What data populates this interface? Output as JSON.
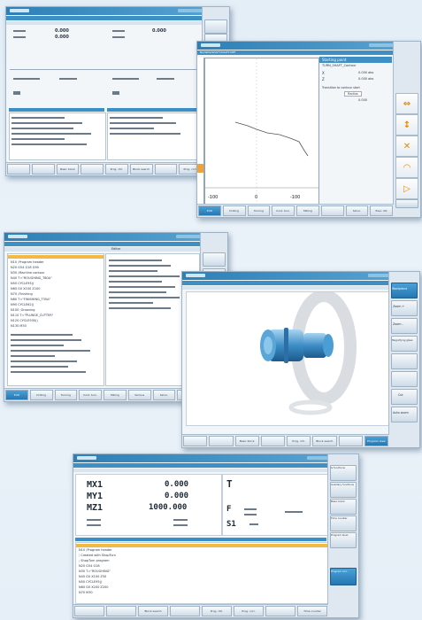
{
  "screen1": {
    "values": [
      "0.000",
      "0.000",
      "0.000"
    ],
    "side_labels": [
      "Machine",
      "Position",
      "Set value"
    ],
    "hbar": [
      "",
      "",
      "Basic block",
      "",
      "Prog. ctrl.",
      "Block search",
      "",
      "Prog. corr."
    ]
  },
  "screen2": {
    "header": "NC/WKS/SHAFT/SHAFT.MPF",
    "panel_title": "Starting point",
    "panel_sub": "TURN_SHAFT_Contour",
    "fields": [
      {
        "label": "X",
        "value": "0.000 abs"
      },
      {
        "label": "Z",
        "value": "0.000 abs"
      }
    ],
    "transition_title": "Transition to contour start",
    "transition_value": "Radius",
    "r_value": "0.000",
    "axis_ticks": [
      "-100",
      "0",
      "-100"
    ],
    "side_icons": [
      "⇔",
      "↕",
      "✕",
      "◠",
      "▷"
    ],
    "hbar": [
      "Edit",
      "Drilling",
      "Turning",
      "Cont. turn.",
      "Milling",
      "",
      "Simul.",
      "Exec. NC"
    ]
  },
  "screen3": {
    "title": "Editor",
    "lines": [
      "N10 ;Program header",
      "N20 G54 G18 G90",
      "N30 ;Machine contour",
      "N40 T=\"ROUGHING_T80A\"",
      "N50 CYCLE95()",
      "N60 G0 X100 Z100",
      "N70 ;Finishing",
      "N80 T=\"FINISHING_T35A\"",
      "N90 CYCLE62()",
      "N100 ;Grooving",
      "N110 T=\"PLUNGE_CUTTER\"",
      "N120 CYCLE930()",
      "N130 M30"
    ],
    "hbar": [
      "Edit",
      "Drilling",
      "Turning",
      "Cont. turn.",
      "Milling",
      "Various",
      "Simul.",
      "Exec. NC"
    ]
  },
  "screen4": {
    "side": [
      "Workpiece",
      "Zoom +",
      "Zoom -",
      "Magnifying glass",
      "",
      "",
      "Cut",
      "Auto zoom"
    ],
    "hbar": [
      "",
      "",
      "Basic block",
      "",
      "Prog. ctrl.",
      "Block search",
      "",
      "Program view"
    ]
  },
  "screen5": {
    "axes": [
      {
        "name": "MX1",
        "value": "0.000"
      },
      {
        "name": "MY1",
        "value": "0.000"
      },
      {
        "name": "MZ1",
        "value": "1000.000"
      }
    ],
    "t_label": "T",
    "f_label": "F",
    "s_label": "S1",
    "prog_lines": [
      "N10 ;Program header",
      "; Created with ShopTurn",
      "; ShopTurn program",
      "N20 G54 G18",
      "N30 T=\"ROUGHING\"",
      "N40 G0 X100 Z50",
      "N50 CYCLE95()",
      "N60 G0 X200 Z200",
      "N70 M30"
    ],
    "side": [
      "G functions",
      "Auxiliary functions",
      "Basic block",
      "Time counter",
      "Program level",
      "",
      "",
      "Program corr."
    ],
    "hbar": [
      "",
      "",
      "Block search",
      "",
      "Prog. ctrl.",
      "Prog. corr.",
      "",
      "Time counter"
    ]
  },
  "colors": {
    "accent": "#2d7fb6",
    "selected": "#f0a23a",
    "background": "#e6eff7"
  }
}
